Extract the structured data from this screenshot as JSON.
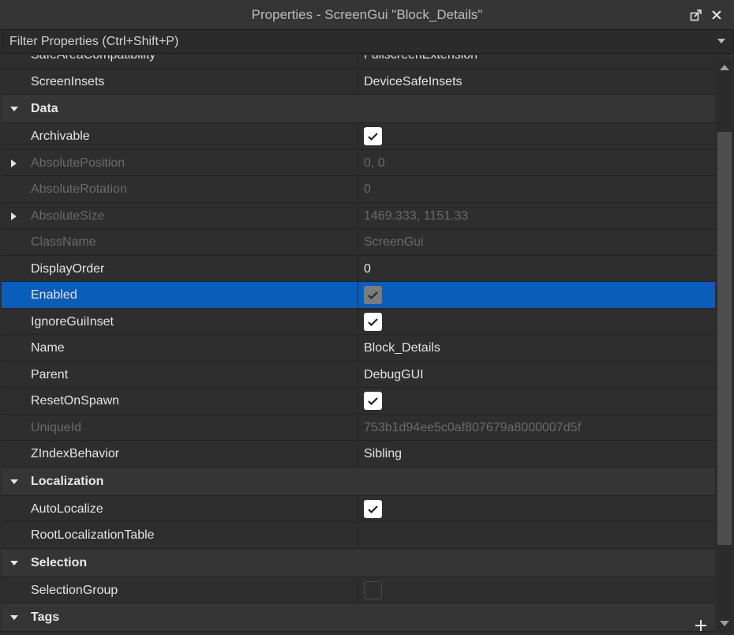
{
  "window": {
    "title": "Properties - ScreenGui \"Block_Details\"",
    "undock_icon": "undock-icon",
    "close_icon": "close-icon"
  },
  "filter": {
    "placeholder": "Filter Properties (Ctrl+Shift+P)"
  },
  "properties": {
    "top": [
      {
        "name": "SafeAreaCompatibility",
        "value": "FullscreenExtension",
        "type": "text"
      },
      {
        "name": "ScreenInsets",
        "value": "DeviceSafeInsets",
        "type": "text"
      }
    ],
    "data_category": {
      "label": "Data"
    },
    "data": [
      {
        "name": "Archivable",
        "type": "checkbox",
        "checked": true
      },
      {
        "name": "AbsolutePosition",
        "value": "0, 0",
        "type": "text",
        "disabled": true,
        "expandable": true
      },
      {
        "name": "AbsoluteRotation",
        "value": "0",
        "type": "text",
        "disabled": true
      },
      {
        "name": "AbsoluteSize",
        "value": "1469.333, 1151.33",
        "type": "text",
        "disabled": true,
        "expandable": true
      },
      {
        "name": "ClassName",
        "value": "ScreenGui",
        "type": "text",
        "disabled": true
      },
      {
        "name": "DisplayOrder",
        "value": "0",
        "type": "text"
      },
      {
        "name": "Enabled",
        "type": "checkbox",
        "checked": true,
        "selected": true
      },
      {
        "name": "IgnoreGuiInset",
        "type": "checkbox",
        "checked": true
      },
      {
        "name": "Name",
        "value": "Block_Details",
        "type": "text"
      },
      {
        "name": "Parent",
        "value": "DebugGUI",
        "type": "text"
      },
      {
        "name": "ResetOnSpawn",
        "type": "checkbox",
        "checked": true
      },
      {
        "name": "UniqueId",
        "value": "753b1d94ee5c0af807679a8000007d5f",
        "type": "text",
        "disabled": true
      },
      {
        "name": "ZIndexBehavior",
        "value": "Sibling",
        "type": "text"
      }
    ],
    "localization_category": {
      "label": "Localization"
    },
    "localization": [
      {
        "name": "AutoLocalize",
        "type": "checkbox",
        "checked": true
      },
      {
        "name": "RootLocalizationTable",
        "value": "",
        "type": "text"
      }
    ],
    "selection_category": {
      "label": "Selection"
    },
    "selection": [
      {
        "name": "SelectionGroup",
        "type": "checkbox",
        "checked": false
      }
    ],
    "tags_category": {
      "label": "Tags"
    }
  },
  "colors": {
    "selected_row": "#0b5dba",
    "background": "#2e2e2e",
    "category_header": "#353535"
  }
}
